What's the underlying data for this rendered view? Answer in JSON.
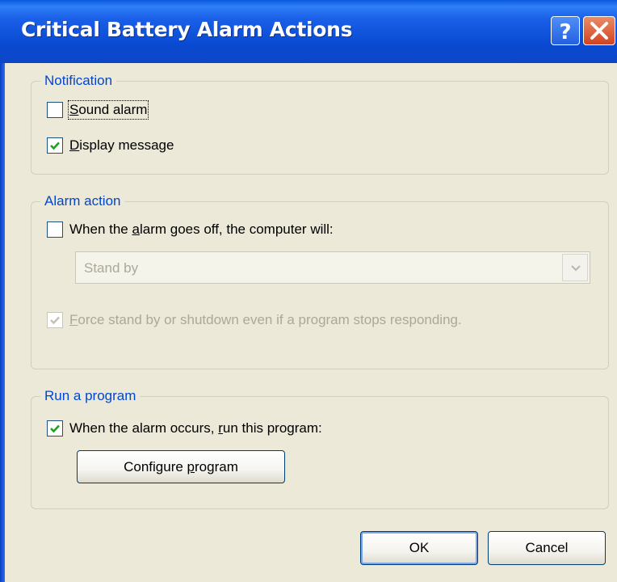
{
  "window": {
    "title": "Critical Battery Alarm Actions"
  },
  "notification": {
    "legend": "Notification",
    "sound_alarm": {
      "prefix": "",
      "key": "S",
      "rest": "ound alarm",
      "checked": false
    },
    "display_message": {
      "prefix": "",
      "key": "D",
      "rest": "isplay message",
      "checked": true
    }
  },
  "alarm_action": {
    "legend": "Alarm action",
    "when_alarm": {
      "prefix": "When the ",
      "key": "a",
      "rest": "larm goes off, the computer will:",
      "checked": false
    },
    "select_value": "Stand by",
    "force": {
      "prefix": "",
      "key": "F",
      "rest": "orce stand by or shutdown even if a program stops responding.",
      "checked": true,
      "disabled": true
    }
  },
  "run_program": {
    "legend": "Run a program",
    "when_occurs": {
      "prefix": "When the alarm occurs, ",
      "key": "r",
      "rest": "un this program:",
      "checked": true
    },
    "configure": {
      "prefix": "Configure ",
      "key": "p",
      "rest": "rogram"
    }
  },
  "buttons": {
    "ok": "OK",
    "cancel": "Cancel"
  },
  "icons": {
    "help": "help-question-icon",
    "close": "close-x-icon",
    "check": "checkmark-icon",
    "dropdown": "chevron-down-icon"
  },
  "colors": {
    "titlebar": "#0a4ad2",
    "legend_text": "#0046d5",
    "check_green": "#21a121",
    "disabled_text": "#aca899",
    "dialog_bg": "#ece9d8"
  }
}
